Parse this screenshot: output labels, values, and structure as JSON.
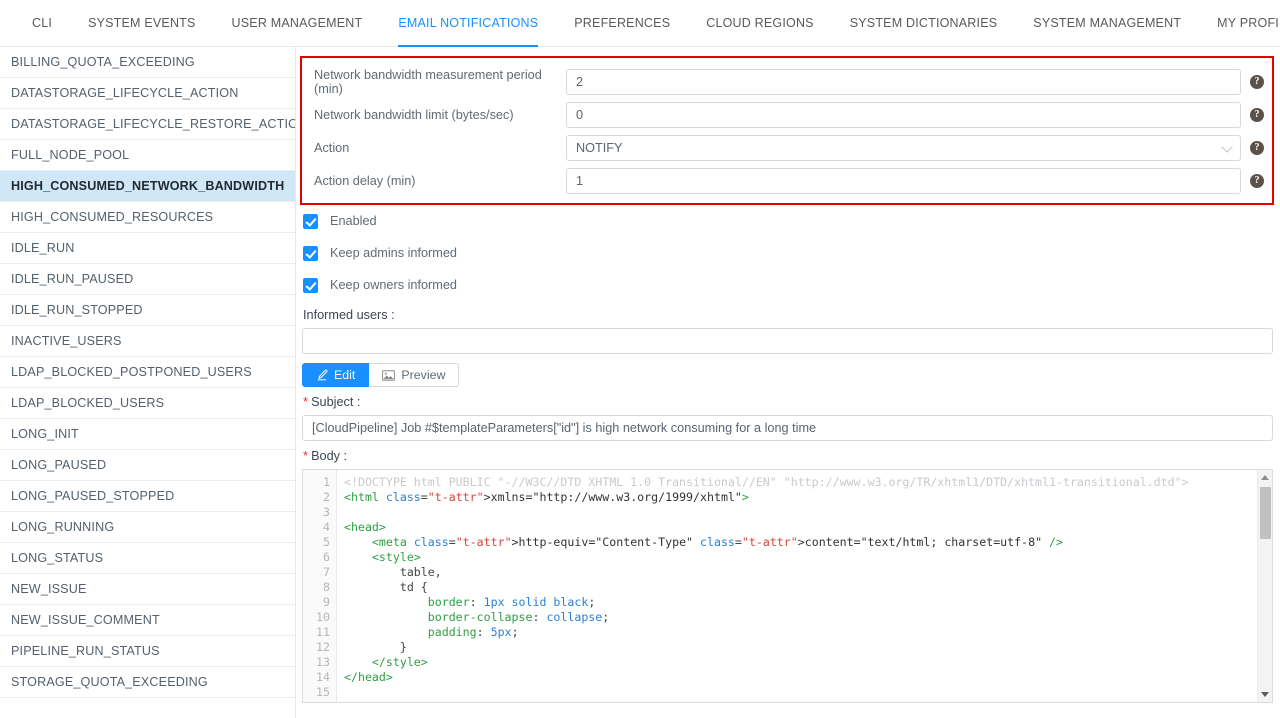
{
  "tabs": [
    {
      "label": "CLI",
      "active": false
    },
    {
      "label": "SYSTEM EVENTS",
      "active": false
    },
    {
      "label": "USER MANAGEMENT",
      "active": false
    },
    {
      "label": "EMAIL NOTIFICATIONS",
      "active": true
    },
    {
      "label": "PREFERENCES",
      "active": false
    },
    {
      "label": "CLOUD REGIONS",
      "active": false
    },
    {
      "label": "SYSTEM DICTIONARIES",
      "active": false
    },
    {
      "label": "SYSTEM MANAGEMENT",
      "active": false
    },
    {
      "label": "MY PROFILE",
      "active": false
    }
  ],
  "sidebar": {
    "items": [
      {
        "label": "BILLING_QUOTA_EXCEEDING",
        "selected": false
      },
      {
        "label": "DATASTORAGE_LIFECYCLE_ACTION",
        "selected": false
      },
      {
        "label": "DATASTORAGE_LIFECYCLE_RESTORE_ACTION",
        "selected": false
      },
      {
        "label": "FULL_NODE_POOL",
        "selected": false
      },
      {
        "label": "HIGH_CONSUMED_NETWORK_BANDWIDTH",
        "selected": true
      },
      {
        "label": "HIGH_CONSUMED_RESOURCES",
        "selected": false
      },
      {
        "label": "IDLE_RUN",
        "selected": false
      },
      {
        "label": "IDLE_RUN_PAUSED",
        "selected": false
      },
      {
        "label": "IDLE_RUN_STOPPED",
        "selected": false
      },
      {
        "label": "INACTIVE_USERS",
        "selected": false
      },
      {
        "label": "LDAP_BLOCKED_POSTPONED_USERS",
        "selected": false
      },
      {
        "label": "LDAP_BLOCKED_USERS",
        "selected": false
      },
      {
        "label": "LONG_INIT",
        "selected": false
      },
      {
        "label": "LONG_PAUSED",
        "selected": false
      },
      {
        "label": "LONG_PAUSED_STOPPED",
        "selected": false
      },
      {
        "label": "LONG_RUNNING",
        "selected": false
      },
      {
        "label": "LONG_STATUS",
        "selected": false
      },
      {
        "label": "NEW_ISSUE",
        "selected": false
      },
      {
        "label": "NEW_ISSUE_COMMENT",
        "selected": false
      },
      {
        "label": "PIPELINE_RUN_STATUS",
        "selected": false
      },
      {
        "label": "STORAGE_QUOTA_EXCEEDING",
        "selected": false
      }
    ]
  },
  "parameters": [
    {
      "label": "Network bandwidth measurement period (min)",
      "value": "2",
      "type": "text",
      "help": "?"
    },
    {
      "label": "Network bandwidth limit (bytes/sec)",
      "value": "0",
      "type": "text",
      "help": "?"
    },
    {
      "label": "Action",
      "value": "NOTIFY",
      "type": "select",
      "help": "?"
    },
    {
      "label": "Action delay (min)",
      "value": "1",
      "type": "text",
      "help": "?"
    }
  ],
  "checkboxes": [
    {
      "label": "Enabled",
      "checked": true
    },
    {
      "label": "Keep admins informed",
      "checked": true
    },
    {
      "label": "Keep owners informed",
      "checked": true
    }
  ],
  "informed_users": {
    "label": "Informed users :",
    "value": ""
  },
  "editor_toggle": {
    "edit_label": "Edit",
    "preview_label": "Preview",
    "active": "Edit"
  },
  "subject": {
    "label": "Subject :",
    "required_mark": "*",
    "value": "[CloudPipeline] Job #$templateParameters[\"id\"] is high network consuming for a long time"
  },
  "body": {
    "label": "Body :",
    "required_mark": "*",
    "line_numbers": [
      "1",
      "2",
      "3",
      "4",
      "5",
      "6",
      "7",
      "8",
      "9",
      "10",
      "11",
      "12",
      "13",
      "14",
      "15"
    ],
    "lines": [
      "<!DOCTYPE html PUBLIC \"-//W3C//DTD XHTML 1.0 Transitional//EN\" \"http://www.w3.org/TR/xhtml1/DTD/xhtml1-transitional.dtd\">",
      "<html xmlns=\"http://www.w3.org/1999/xhtml\">",
      "",
      "<head>",
      "    <meta http-equiv=\"Content-Type\" content=\"text/html; charset=utf-8\" />",
      "    <style>",
      "        table,",
      "        td {",
      "            border: 1px solid black;",
      "            border-collapse: collapse;",
      "            padding: 5px;",
      "        }",
      "    </style>",
      "</head>",
      ""
    ]
  },
  "colors": {
    "accent": "#1890ff",
    "highlight_box": "#e60000",
    "selected_row": "#cfe7f7",
    "required_star": "#e63030"
  }
}
